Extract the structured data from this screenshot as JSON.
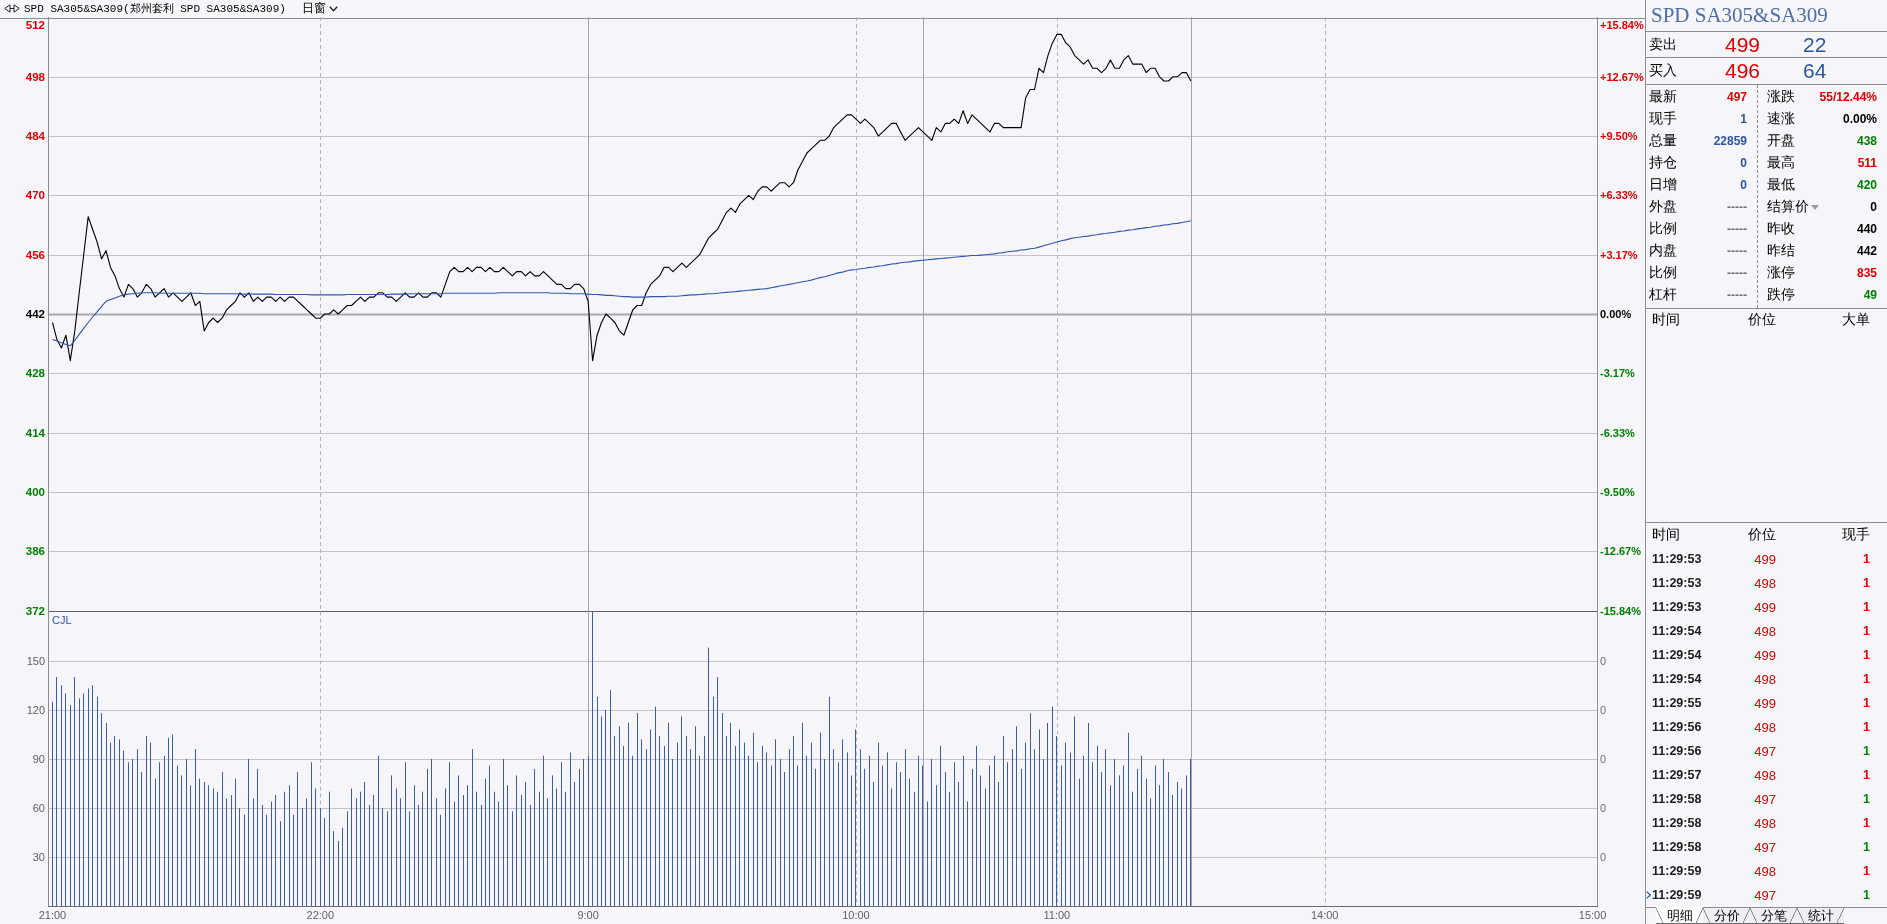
{
  "header": {
    "title": "SPD SA305&SA309(郑州套利 SPD SA305&SA309)",
    "period": "日窗"
  },
  "price_chart": {
    "percent_labels": [
      {
        "text": "+15.84%",
        "color": "#e00000"
      },
      {
        "text": "+12.67%",
        "color": "#e00000"
      },
      {
        "text": "+9.50%",
        "color": "#e00000"
      },
      {
        "text": "+6.33%",
        "color": "#e00000"
      },
      {
        "text": "+3.17%",
        "color": "#e00000"
      },
      {
        "text": "0.00%",
        "color": "#000000"
      },
      {
        "text": "-3.17%",
        "color": "#008000"
      },
      {
        "text": "-6.33%",
        "color": "#008000"
      },
      {
        "text": "-9.50%",
        "color": "#008000"
      },
      {
        "text": "-12.67%",
        "color": "#008000"
      },
      {
        "text": "-15.84%",
        "color": "#008000"
      }
    ],
    "chart_data": {
      "type": "line",
      "grid": true,
      "categories": [
        null,
        null,
        null,
        null,
        null,
        null,
        null,
        null,
        null,
        null,
        null,
        null,
        null,
        null,
        null,
        null,
        null,
        null,
        null,
        null,
        null,
        null,
        null,
        null,
        null,
        null,
        null,
        null,
        null,
        null,
        null,
        null,
        null,
        null,
        null,
        null,
        null,
        null,
        null,
        null,
        null,
        null,
        null,
        null,
        null,
        null,
        null,
        null,
        null,
        null,
        null,
        null,
        null,
        null,
        null,
        null,
        null,
        null,
        null,
        null,
        null,
        null,
        null,
        null,
        null,
        null,
        null,
        null,
        null,
        null,
        null,
        null,
        null,
        null,
        null,
        null,
        null,
        null,
        null,
        null,
        null,
        null,
        null,
        null,
        null,
        null,
        null,
        null,
        null,
        null,
        null,
        null,
        null,
        null,
        null,
        null,
        null,
        null,
        null,
        null,
        null,
        null,
        null,
        null,
        null,
        null,
        null,
        null,
        null,
        null,
        null,
        null,
        null,
        null,
        null,
        null,
        null,
        null,
        null,
        null,
        null,
        null,
        null,
        null,
        null,
        null,
        null,
        null,
        null,
        null,
        null,
        null,
        null,
        null,
        null,
        null,
        null,
        null,
        null,
        null,
        null,
        null,
        null,
        null,
        null,
        null,
        null,
        null,
        null,
        null,
        null,
        null,
        null,
        null,
        null,
        null,
        null,
        null,
        null,
        null,
        null,
        null,
        null,
        null,
        null,
        null,
        null,
        null,
        null,
        null,
        null,
        null,
        null,
        null,
        null,
        null,
        null,
        null,
        null,
        null,
        null,
        null,
        null,
        null,
        null,
        null,
        null,
        null,
        null,
        null,
        null,
        null,
        null,
        null,
        null,
        null,
        null,
        null,
        null,
        null,
        null,
        null,
        null,
        null,
        null,
        null,
        null,
        null,
        null,
        null,
        null,
        null,
        null,
        null,
        null,
        null,
        null,
        null,
        null,
        null,
        null,
        null,
        null,
        null,
        null,
        null,
        null,
        null,
        null,
        null,
        null,
        null,
        null,
        null,
        null,
        null,
        null,
        null,
        null,
        null,
        null,
        null,
        null,
        null,
        null,
        null,
        null,
        null,
        null,
        null,
        null,
        null,
        null,
        null,
        null,
        null,
        null,
        null,
        null,
        null,
        null,
        null,
        null,
        null,
        null,
        null,
        null,
        null,
        null,
        null,
        null,
        null,
        null,
        null,
        null,
        null,
        null,
        null,
        null,
        null,
        null,
        null,
        null,
        null,
        null,
        null,
        null,
        null,
        null,
        null,
        null,
        null,
        null,
        null,
        null,
        null,
        null,
        null,
        null,
        null,
        null,
        null,
        null,
        null,
        null,
        null,
        null,
        null,
        null,
        null,
        null,
        null,
        null,
        null,
        null,
        null,
        null,
        null,
        null,
        null,
        null,
        null,
        null,
        null,
        null,
        null,
        null,
        null,
        null,
        null,
        null,
        null,
        null,
        null,
        null,
        null,
        null,
        null,
        null,
        null,
        null,
        null,
        null,
        null,
        null,
        null
      ],
      "series": [
        {
          "color": "#000000",
          "values": [
            440,
            436,
            434,
            437,
            431,
            438,
            447,
            456,
            465,
            462,
            459,
            455,
            457,
            453,
            451,
            448,
            446,
            449,
            448,
            446,
            447,
            449,
            448,
            446,
            447,
            448,
            446,
            447,
            446,
            445,
            446,
            447,
            444,
            445,
            438,
            440,
            441,
            440,
            441,
            443,
            444,
            445,
            447,
            446,
            447,
            445,
            446,
            445,
            446,
            446,
            445,
            446,
            445,
            446,
            446,
            445,
            444,
            443,
            442,
            441,
            441,
            442,
            442,
            443,
            442,
            443,
            444,
            444,
            445,
            446,
            445,
            446,
            446,
            447,
            447,
            446,
            446,
            445,
            446,
            447,
            446,
            446,
            447,
            446,
            446,
            447,
            447,
            446,
            449,
            452,
            453,
            452,
            452,
            453,
            452,
            453,
            453,
            452,
            453,
            452,
            452,
            453,
            452,
            451,
            452,
            452,
            451,
            452,
            451,
            451,
            452,
            451,
            450,
            449,
            449,
            448,
            448,
            449,
            449,
            448,
            445,
            431,
            437,
            440,
            442,
            441,
            440,
            438,
            437,
            440,
            443,
            444,
            444,
            447,
            449,
            450,
            451,
            453,
            453,
            452,
            453,
            454,
            453,
            454,
            455,
            456,
            458,
            460,
            461,
            462,
            464,
            466,
            467,
            466,
            468,
            469,
            470,
            469,
            471,
            472,
            472,
            471,
            472,
            473,
            473,
            472,
            473,
            476,
            478,
            480,
            481,
            482,
            483,
            483,
            484,
            486,
            487,
            488,
            489,
            489,
            488,
            487,
            488,
            487,
            486,
            484,
            485,
            486,
            487,
            487,
            485,
            483,
            484,
            485,
            486,
            485,
            484,
            483,
            486,
            485,
            487,
            487,
            488,
            487,
            490,
            487,
            489,
            488,
            487,
            486,
            485,
            487,
            487,
            486,
            486,
            486,
            486,
            486,
            493,
            495,
            495,
            500,
            499,
            503,
            506,
            508,
            508,
            506,
            505,
            503,
            502,
            501,
            502,
            500,
            500,
            499,
            500,
            502,
            500,
            500,
            502,
            503,
            501,
            501,
            501,
            499,
            500,
            500,
            498,
            497,
            497,
            498,
            498,
            499,
            499,
            497,
            null,
            null,
            null,
            null,
            null,
            null,
            null,
            null,
            null,
            null,
            null,
            null,
            null,
            null,
            null,
            null,
            null,
            null,
            null,
            null,
            null,
            null,
            null,
            null,
            null,
            null,
            null,
            null,
            null,
            null,
            null,
            null,
            null,
            null,
            null,
            null,
            null,
            null,
            null,
            null,
            null,
            null,
            null,
            null,
            null,
            null,
            null,
            null,
            null,
            null,
            null,
            null,
            null,
            null,
            null,
            null,
            null,
            null,
            null,
            null,
            null,
            null,
            null,
            null,
            null,
            null,
            null,
            null,
            null,
            null,
            null,
            null,
            null,
            null,
            null,
            null,
            null,
            null,
            null,
            null,
            null,
            null,
            null,
            null,
            null,
            null,
            null,
            null,
            null,
            null
          ]
        },
        {
          "color": "#3355aa",
          "values": [
            436,
            435.6,
            435.2,
            434.8,
            434.5,
            435.8,
            437.2,
            438.6,
            440,
            441.3,
            442.5,
            443.8,
            445,
            445.4,
            445.8,
            446.2,
            446.5,
            446.7,
            446.8,
            446.9,
            447,
            447,
            447,
            447,
            446.9,
            446.9,
            446.9,
            446.9,
            446.9,
            446.9,
            446.9,
            446.9,
            446.9,
            446.9,
            446.8,
            446.8,
            446.8,
            446.8,
            446.8,
            446.8,
            446.8,
            446.8,
            446.7,
            446.7,
            446.7,
            446.7,
            446.7,
            446.7,
            446.7,
            446.7,
            446.6,
            446.6,
            446.6,
            446.6,
            446.6,
            446.6,
            446.6,
            446.6,
            446.5,
            446.5,
            446.5,
            446.5,
            446.5,
            446.5,
            446.5,
            446.5,
            446.6,
            446.6,
            446.6,
            446.6,
            446.6,
            446.6,
            446.6,
            446.6,
            446.6,
            446.6,
            446.7,
            446.7,
            446.7,
            446.7,
            446.8,
            446.8,
            446.8,
            446.8,
            446.8,
            446.8,
            446.8,
            446.8,
            446.9,
            446.9,
            446.9,
            446.9,
            446.9,
            446.9,
            446.9,
            446.9,
            446.9,
            446.9,
            446.9,
            446.9,
            447,
            447,
            447,
            447,
            447,
            447,
            447,
            447,
            447,
            447,
            447,
            447,
            446.9,
            446.9,
            446.9,
            446.9,
            446.8,
            446.8,
            446.8,
            446.8,
            446.7,
            446.6,
            446.6,
            446.5,
            446.4,
            446.4,
            446.3,
            446.2,
            446.1,
            446.1,
            446,
            446,
            446,
            446,
            446.1,
            446.1,
            446.1,
            446.1,
            446.2,
            446.2,
            446.2,
            446.3,
            446.4,
            446.5,
            446.5,
            446.6,
            446.7,
            446.8,
            446.8,
            446.9,
            447,
            447.1,
            447.2,
            447.3,
            447.4,
            447.5,
            447.6,
            447.7,
            447.8,
            447.9,
            448,
            448.2,
            448.4,
            448.6,
            448.8,
            449,
            449.2,
            449.4,
            449.6,
            449.8,
            450,
            450.3,
            450.6,
            450.8,
            451.1,
            451.4,
            451.7,
            451.9,
            452.2,
            452.4,
            452.5,
            452.7,
            452.8,
            453,
            453.1,
            453.3,
            453.4,
            453.6,
            453.8,
            453.9,
            454.1,
            454.2,
            454.3,
            454.5,
            454.6,
            454.7,
            454.8,
            454.9,
            455,
            455.1,
            455.2,
            455.3,
            455.4,
            455.5,
            455.6,
            455.7,
            455.8,
            455.8,
            455.9,
            456,
            456.1,
            456.2,
            456.4,
            456.5,
            456.7,
            456.8,
            456.9,
            457.1,
            457.2,
            457.4,
            457.5,
            457.8,
            458.1,
            458.4,
            458.7,
            459,
            459.3,
            459.5,
            459.8,
            460,
            460.1,
            460.3,
            460.4,
            460.6,
            460.7,
            460.9,
            461,
            461.2,
            461.3,
            461.5,
            461.6,
            461.8,
            461.9,
            462.1,
            462.2,
            462.4,
            462.5,
            462.7,
            462.8,
            463,
            463.1,
            463.3,
            463.4,
            463.6,
            463.8,
            464,
            null,
            null,
            null,
            null,
            null,
            null,
            null,
            null,
            null,
            null,
            null,
            null,
            null,
            null,
            null,
            null,
            null,
            null,
            null,
            null,
            null,
            null,
            null,
            null,
            null,
            null,
            null,
            null,
            null,
            null,
            null,
            null,
            null,
            null,
            null,
            null,
            null,
            null,
            null,
            null,
            null,
            null,
            null,
            null,
            null,
            null,
            null,
            null,
            null,
            null,
            null,
            null,
            null,
            null,
            null,
            null,
            null,
            null,
            null,
            null,
            null,
            null,
            null,
            null,
            null,
            null,
            null,
            null,
            null,
            null,
            null,
            null,
            null,
            null,
            null,
            null,
            null,
            null,
            null,
            null,
            null,
            null,
            null,
            null,
            null,
            null,
            null,
            null,
            null,
            null
          ]
        }
      ],
      "ylim": [
        372,
        512
      ],
      "yticks": [
        512,
        498,
        484,
        470,
        456,
        442,
        428,
        414,
        400,
        386,
        372
      ],
      "ref_lines": [
        {
          "axis": "y",
          "value": 442
        }
      ]
    }
  },
  "volume_chart": {
    "right_labels": [
      "0",
      "0",
      "0",
      "0",
      "0"
    ],
    "chart_data": {
      "type": "bar",
      "title": "CJL",
      "grid": true,
      "categories": [
        "21:00",
        null,
        null,
        null,
        null,
        null,
        null,
        null,
        null,
        null,
        null,
        null,
        null,
        null,
        null,
        null,
        null,
        null,
        null,
        null,
        null,
        null,
        null,
        null,
        null,
        null,
        null,
        null,
        null,
        null,
        null,
        null,
        null,
        null,
        null,
        null,
        null,
        null,
        null,
        null,
        null,
        null,
        null,
        null,
        null,
        null,
        null,
        null,
        null,
        null,
        null,
        null,
        null,
        null,
        null,
        null,
        null,
        null,
        null,
        null,
        "22:00",
        null,
        null,
        null,
        null,
        null,
        null,
        null,
        null,
        null,
        null,
        null,
        null,
        null,
        null,
        null,
        null,
        null,
        null,
        null,
        null,
        null,
        null,
        null,
        null,
        null,
        null,
        null,
        null,
        null,
        null,
        null,
        null,
        null,
        null,
        null,
        null,
        null,
        null,
        null,
        null,
        null,
        null,
        null,
        null,
        null,
        null,
        null,
        null,
        null,
        null,
        null,
        null,
        null,
        null,
        null,
        null,
        null,
        null,
        null,
        "9:00",
        null,
        null,
        null,
        null,
        null,
        null,
        null,
        null,
        null,
        null,
        null,
        null,
        null,
        null,
        null,
        null,
        null,
        null,
        null,
        null,
        null,
        null,
        null,
        null,
        null,
        null,
        null,
        null,
        null,
        null,
        null,
        null,
        null,
        null,
        null,
        null,
        null,
        null,
        null,
        null,
        null,
        null,
        null,
        null,
        null,
        null,
        null,
        null,
        null,
        null,
        null,
        null,
        null,
        null,
        null,
        null,
        null,
        null,
        null,
        "10:00",
        null,
        null,
        null,
        null,
        null,
        null,
        null,
        null,
        null,
        null,
        null,
        null,
        null,
        null,
        null,
        null,
        null,
        null,
        null,
        null,
        null,
        null,
        null,
        null,
        null,
        null,
        null,
        null,
        null,
        null,
        null,
        null,
        null,
        null,
        null,
        null,
        null,
        null,
        null,
        null,
        null,
        null,
        null,
        null,
        "11:00",
        null,
        null,
        null,
        null,
        null,
        null,
        null,
        null,
        null,
        null,
        null,
        null,
        null,
        null,
        null,
        null,
        null,
        null,
        null,
        null,
        null,
        null,
        null,
        null,
        null,
        null,
        null,
        null,
        null,
        null,
        null,
        null,
        null,
        null,
        null,
        null,
        null,
        null,
        null,
        null,
        null,
        null,
        null,
        null,
        null,
        null,
        null,
        null,
        null,
        null,
        null,
        null,
        null,
        null,
        null,
        null,
        null,
        null,
        null,
        "14:00",
        null,
        null,
        null,
        null,
        null,
        null,
        null,
        null,
        null,
        null,
        null,
        null,
        null,
        null,
        null,
        null,
        null,
        null,
        null,
        null,
        null,
        null,
        null,
        null,
        null,
        null,
        null,
        null,
        null,
        null,
        null,
        null,
        null,
        null,
        null,
        null,
        null,
        null,
        null,
        null,
        null,
        null,
        null,
        null,
        null,
        null,
        null,
        null,
        null,
        null,
        null,
        null,
        null,
        null,
        null,
        null,
        null,
        null,
        null,
        "15:00"
      ],
      "values": [
        125,
        140,
        135,
        130,
        123,
        140,
        127,
        130,
        133,
        135,
        128,
        118,
        112,
        100,
        104,
        102,
        95,
        88,
        90,
        96,
        82,
        104,
        100,
        78,
        88,
        92,
        103,
        105,
        86,
        80,
        90,
        74,
        96,
        78,
        76,
        74,
        72,
        70,
        82,
        66,
        68,
        78,
        60,
        56,
        90,
        66,
        84,
        62,
        56,
        64,
        68,
        52,
        70,
        74,
        56,
        82,
        60,
        66,
        88,
        72,
        60,
        54,
        70,
        46,
        40,
        48,
        58,
        72,
        66,
        70,
        76,
        62,
        68,
        92,
        60,
        58,
        80,
        72,
        66,
        88,
        58,
        74,
        62,
        70,
        84,
        90,
        66,
        56,
        72,
        88,
        64,
        80,
        68,
        74,
        96,
        70,
        62,
        78,
        86,
        70,
        64,
        90,
        74,
        58,
        80,
        68,
        76,
        62,
        84,
        70,
        92,
        66,
        80,
        72,
        88,
        70,
        94,
        76,
        84,
        90,
        92,
        180,
        128,
        116,
        120,
        132,
        104,
        110,
        98,
        112,
        92,
        118,
        102,
        96,
        108,
        122,
        104,
        98,
        112,
        90,
        100,
        116,
        104,
        96,
        110,
        92,
        104,
        158,
        128,
        140,
        118,
        104,
        112,
        98,
        108,
        100,
        92,
        106,
        88,
        98,
        94,
        86,
        102,
        90,
        82,
        96,
        104,
        86,
        112,
        92,
        100,
        84,
        106,
        90,
        128,
        96,
        88,
        102,
        94,
        80,
        108,
        96,
        84,
        92,
        76,
        100,
        86,
        94,
        72,
        88,
        82,
        96,
        78,
        70,
        92,
        86,
        64,
        90,
        74,
        98,
        82,
        70,
        88,
        76,
        92,
        64,
        84,
        98,
        80,
        72,
        86,
        92,
        76,
        104,
        88,
        96,
        110,
        84,
        100,
        118,
        96,
        108,
        90,
        112,
        122,
        104,
        86,
        100,
        94,
        116,
        78,
        92,
        112,
        88,
        98,
        82,
        96,
        74,
        90,
        80,
        86,
        106,
        70,
        84,
        92,
        78,
        66,
        86,
        74,
        90,
        82,
        68,
        76,
        72,
        80,
        90,
        null,
        null,
        null,
        null,
        null,
        null,
        null,
        null,
        null,
        null,
        null,
        null,
        null,
        null,
        null,
        null,
        null,
        null,
        null,
        null,
        null,
        null,
        null,
        null,
        null,
        null,
        null,
        null,
        null,
        null,
        null,
        null,
        null,
        null,
        null,
        null,
        null,
        null,
        null,
        null,
        null,
        null,
        null,
        null,
        null,
        null,
        null,
        null,
        null,
        null,
        null,
        null,
        null,
        null,
        null,
        null,
        null,
        null,
        null,
        null,
        null,
        null,
        null,
        null,
        null,
        null,
        null,
        null,
        null,
        null,
        null,
        null,
        null,
        null,
        null,
        null,
        null,
        null,
        null,
        null,
        null,
        null,
        null,
        null,
        null,
        null,
        null,
        null,
        null,
        null
      ],
      "ylim": [
        0,
        180
      ],
      "yticks": [
        150,
        120,
        90,
        60,
        30
      ]
    }
  },
  "quote": {
    "title": "SPD SA305&SA309",
    "ask": {
      "label": "卖出",
      "price": "499",
      "color": "#e00000",
      "volume": "22"
    },
    "bid": {
      "label": "买入",
      "price": "496",
      "color": "#e00000",
      "volume": "64"
    },
    "stats": [
      {
        "left": {
          "label": "最新",
          "value": "497",
          "color": "#e00000"
        },
        "right": {
          "label": "涨跌",
          "value": "55/12.44%",
          "color": "#e00000",
          "menu": false
        }
      },
      {
        "left": {
          "label": "现手",
          "value": "1",
          "color": "#2c55a0"
        },
        "right": {
          "label": "速涨",
          "value": "0.00%",
          "color": "#000000",
          "menu": false
        }
      },
      {
        "left": {
          "label": "总量",
          "value": "22859",
          "color": "#2c55a0"
        },
        "right": {
          "label": "开盘",
          "value": "438",
          "color": "#008000",
          "menu": false
        }
      },
      {
        "left": {
          "label": "持仓",
          "value": "0",
          "color": "#2c55a0"
        },
        "right": {
          "label": "最高",
          "value": "511",
          "color": "#e00000",
          "menu": false
        }
      },
      {
        "left": {
          "label": "日增",
          "value": "0",
          "color": "#2c55a0"
        },
        "right": {
          "label": "最低",
          "value": "420",
          "color": "#008000",
          "menu": false
        }
      },
      {
        "left": {
          "label": "外盘",
          "value": "-----",
          "color": "#707070"
        },
        "right": {
          "label": "结算价",
          "value": "0",
          "color": "#000000",
          "menu": true
        }
      },
      {
        "left": {
          "label": "比例",
          "value": "-----",
          "color": "#707070"
        },
        "right": {
          "label": "昨收",
          "value": "440",
          "color": "#000000",
          "menu": false
        }
      },
      {
        "left": {
          "label": "内盘",
          "value": "-----",
          "color": "#707070"
        },
        "right": {
          "label": "昨结",
          "value": "442",
          "color": "#000000",
          "menu": false
        }
      },
      {
        "left": {
          "label": "比例",
          "value": "-----",
          "color": "#707070"
        },
        "right": {
          "label": "涨停",
          "value": "835",
          "color": "#e00000",
          "menu": false
        }
      },
      {
        "left": {
          "label": "杠杆",
          "value": "-----",
          "color": "#707070"
        },
        "right": {
          "label": "跌停",
          "value": "49",
          "color": "#008000",
          "menu": false
        }
      }
    ]
  },
  "big_orders": {
    "columns": [
      "时间",
      "价位",
      "大单"
    ]
  },
  "ticks": {
    "columns": [
      "时间",
      "价位",
      "现手"
    ],
    "rows": [
      {
        "time": "11:29:53",
        "price": {
          "text": "499",
          "color": "#e00000"
        },
        "volume": {
          "text": "1",
          "color": "#e00000"
        },
        "selected": false
      },
      {
        "time": "11:29:53",
        "price": {
          "text": "498",
          "color": "#e00000"
        },
        "volume": {
          "text": "1",
          "color": "#e00000"
        },
        "selected": false
      },
      {
        "time": "11:29:53",
        "price": {
          "text": "499",
          "color": "#e00000"
        },
        "volume": {
          "text": "1",
          "color": "#e00000"
        },
        "selected": false
      },
      {
        "time": "11:29:54",
        "price": {
          "text": "498",
          "color": "#e00000"
        },
        "volume": {
          "text": "1",
          "color": "#e00000"
        },
        "selected": false
      },
      {
        "time": "11:29:54",
        "price": {
          "text": "499",
          "color": "#e00000"
        },
        "volume": {
          "text": "1",
          "color": "#e00000"
        },
        "selected": false
      },
      {
        "time": "11:29:54",
        "price": {
          "text": "498",
          "color": "#e00000"
        },
        "volume": {
          "text": "1",
          "color": "#e00000"
        },
        "selected": false
      },
      {
        "time": "11:29:55",
        "price": {
          "text": "499",
          "color": "#e00000"
        },
        "volume": {
          "text": "1",
          "color": "#e00000"
        },
        "selected": false
      },
      {
        "time": "11:29:56",
        "price": {
          "text": "498",
          "color": "#e00000"
        },
        "volume": {
          "text": "1",
          "color": "#e00000"
        },
        "selected": false
      },
      {
        "time": "11:29:56",
        "price": {
          "text": "497",
          "color": "#e00000"
        },
        "volume": {
          "text": "1",
          "color": "#008000"
        },
        "selected": false
      },
      {
        "time": "11:29:57",
        "price": {
          "text": "498",
          "color": "#e00000"
        },
        "volume": {
          "text": "1",
          "color": "#e00000"
        },
        "selected": false
      },
      {
        "time": "11:29:58",
        "price": {
          "text": "497",
          "color": "#e00000"
        },
        "volume": {
          "text": "1",
          "color": "#008000"
        },
        "selected": false
      },
      {
        "time": "11:29:58",
        "price": {
          "text": "498",
          "color": "#e00000"
        },
        "volume": {
          "text": "1",
          "color": "#e00000"
        },
        "selected": false
      },
      {
        "time": "11:29:58",
        "price": {
          "text": "497",
          "color": "#e00000"
        },
        "volume": {
          "text": "1",
          "color": "#008000"
        },
        "selected": false
      },
      {
        "time": "11:29:59",
        "price": {
          "text": "498",
          "color": "#e00000"
        },
        "volume": {
          "text": "1",
          "color": "#e00000"
        },
        "selected": false
      },
      {
        "time": "11:29:59",
        "price": {
          "text": "497",
          "color": "#e00000"
        },
        "volume": {
          "text": "1",
          "color": "#008000"
        },
        "selected": true
      }
    ]
  },
  "tabs": [
    {
      "label": "明细",
      "selected": true
    },
    {
      "label": "分价",
      "selected": false
    },
    {
      "label": "分笔",
      "selected": false
    },
    {
      "label": "统计",
      "selected": false
    }
  ]
}
